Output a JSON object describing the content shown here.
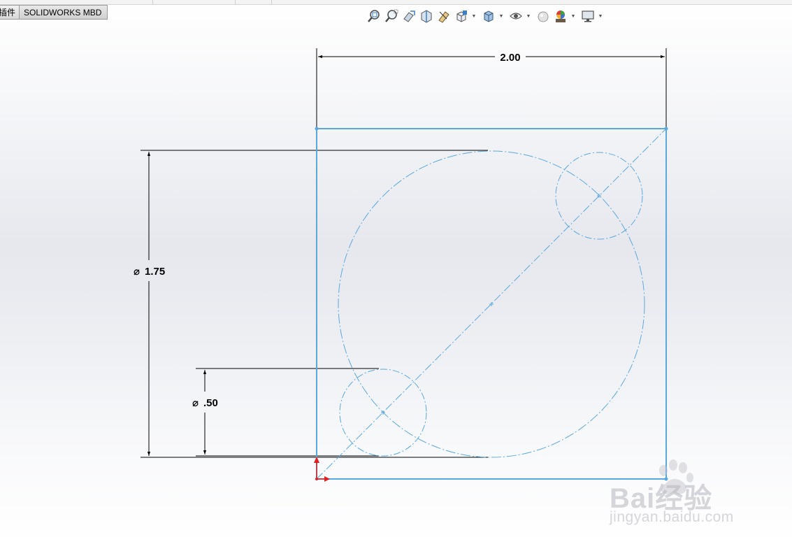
{
  "tabs": [
    {
      "label": "插件"
    },
    {
      "label": "SOLIDWORKS MBD"
    }
  ],
  "toolbar": {
    "icons": [
      "zoom-to-fit-icon",
      "zoom-to-area-icon",
      "previous-view-icon",
      "section-view-icon",
      "dynamic-annotation-icon",
      "view-orientation-icon",
      "display-style-icon",
      "hide-show-items-icon",
      "edit-appearance-icon",
      "apply-scene-icon",
      "view-settings-icon"
    ]
  },
  "sketch": {
    "line_color": "#5aa8e0",
    "dim_color": "#000000",
    "origin_color": "#e02020"
  },
  "dimensions": {
    "width": "2.00",
    "large_diameter": "1.75",
    "small_diameter": ".50",
    "diameter_symbol": "⌀"
  },
  "watermark": {
    "main": "Bai经验",
    "sub": "jingyan.baidu.com"
  }
}
